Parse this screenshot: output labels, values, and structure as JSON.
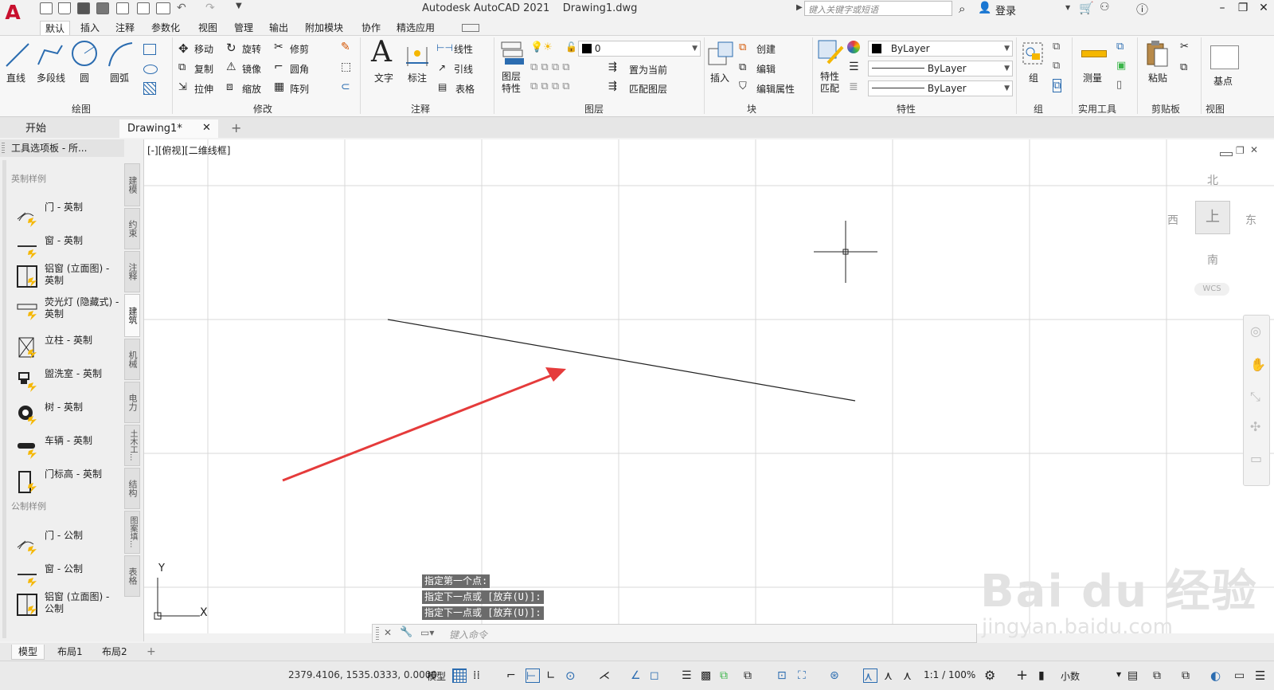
{
  "app": {
    "logo_letter": "A",
    "title": "Autodesk AutoCAD 2021    Drawing1.dwg",
    "search_placeholder": "键入关键字或短语",
    "login": "登录"
  },
  "ribbon_tabs": [
    "默认",
    "插入",
    "注释",
    "参数化",
    "视图",
    "管理",
    "输出",
    "附加模块",
    "协作",
    "精选应用"
  ],
  "ribbon": {
    "draw": {
      "title": "绘图",
      "line": "直线",
      "polyline": "多段线",
      "circle": "圆",
      "arc": "圆弧"
    },
    "modify": {
      "title": "修改",
      "move": "移动",
      "rotate": "旋转",
      "trim": "修剪",
      "copy": "复制",
      "mirror": "镜像",
      "fillet": "圆角",
      "stretch": "拉伸",
      "scale": "缩放",
      "array": "阵列"
    },
    "annotation": {
      "title": "注释",
      "text": "文字",
      "dimension": "标注",
      "linear": "线性",
      "leader": "引线",
      "table": "表格"
    },
    "layers": {
      "title": "图层",
      "layer_props": "图层\n特性",
      "layer_value": "0",
      "set_current": "置为当前",
      "match_layer": "匹配图层"
    },
    "block": {
      "title": "块",
      "insert": "插入",
      "create": "创建",
      "edit": "编辑",
      "edit_attr": "编辑属性"
    },
    "properties": {
      "title": "特性",
      "match": "特性\n匹配",
      "color": "ByLayer",
      "linetype": "ByLayer",
      "lineweight": "ByLayer"
    },
    "groups": {
      "title": "组",
      "group": "组"
    },
    "utilities": {
      "title": "实用工具",
      "measure": "测量"
    },
    "clipboard": {
      "title": "剪贴板",
      "paste": "粘贴"
    },
    "view": {
      "title": "视图",
      "base": "基点"
    }
  },
  "doc_tabs": {
    "start": "开始",
    "drawing": "Drawing1*"
  },
  "palette": {
    "header": "工具选项板 - 所...",
    "section_imperial": "英制样例",
    "section_metric": "公制样例",
    "items": [
      "门 - 英制",
      "窗 - 英制",
      "铝窗 (立面图) - 英制",
      "荧光灯 (隐藏式) - 英制",
      "立柱 - 英制",
      "盥洗室 - 英制",
      "树 - 英制",
      "车辆 - 英制",
      "门标高 - 英制",
      "门 - 公制",
      "窗 - 公制",
      "铝窗 (立面图) - 公制"
    ],
    "vtabs": [
      "建模",
      "约束",
      "注释",
      "建筑",
      "机械",
      "电力",
      "土木工...",
      "结构",
      "图案填...",
      "表格"
    ]
  },
  "canvas": {
    "view_label": "[-][俯视][二维线框]",
    "ucs_y": "Y",
    "ucs_x": "X",
    "command_history": [
      "指定第一个点:",
      "指定下一点或 [放弃(U)]:",
      "指定下一点或 [放弃(U)]:"
    ],
    "command_placeholder": "键入命令"
  },
  "viewcube": {
    "north": "北",
    "south": "南",
    "east": "东",
    "west": "西",
    "top": "上",
    "wcs": "WCS"
  },
  "layout_tabs": [
    "模型",
    "布局1",
    "布局2"
  ],
  "status": {
    "coords": "2379.4106, 1535.0333, 0.0000",
    "model": "模型",
    "scale": "1:1 / 100%",
    "units": "小数"
  },
  "watermark": {
    "brand": "Bai du 经验",
    "url": "jingyan.baidu.com"
  },
  "colors": {
    "accent_red": "#e53b3b",
    "logo_red": "#c8102e",
    "canvas_bg": "#ffffff",
    "grid": "#d9d9d9"
  }
}
